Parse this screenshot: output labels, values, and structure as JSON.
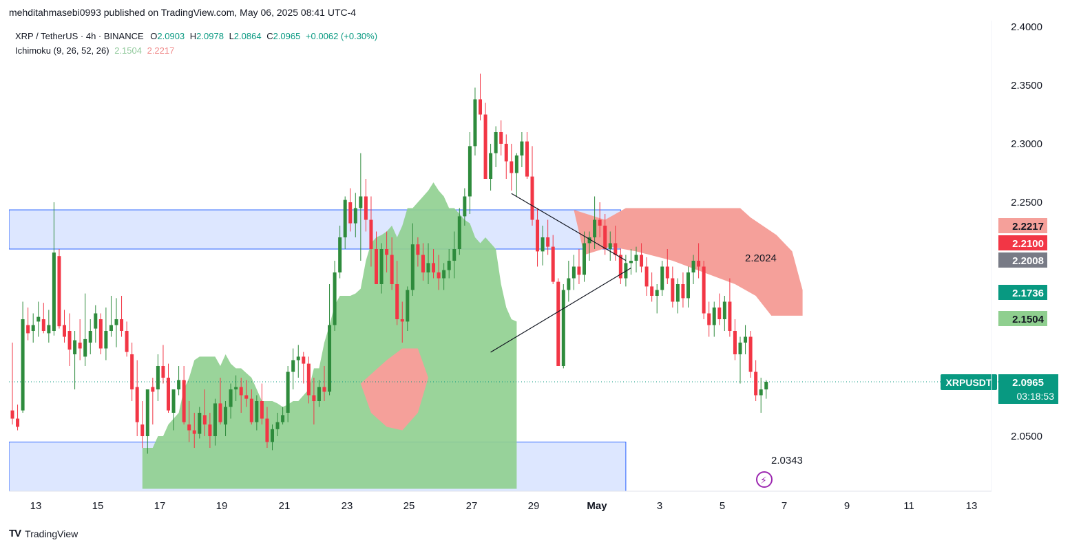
{
  "header": {
    "publisher_line": "mehditahmasebi0993 published on TradingView.com, May 06, 2025 08:41 UTC-4"
  },
  "legend": {
    "symbol": "XRP / TetherUS · 4h · BINANCE",
    "open_label": "O",
    "open": "2.0903",
    "high_label": "H",
    "high": "2.0978",
    "low_label": "L",
    "low": "2.0864",
    "close_label": "C",
    "close": "2.0965",
    "change": "+0.0062 (+0.30%)",
    "indicator": "Ichimoku (9, 26, 52, 26)",
    "indicator_a": "2.1504",
    "indicator_b": "2.2217"
  },
  "footer": {
    "brand": "TradingView"
  },
  "colors": {
    "up": "#089981",
    "up_candle": "#2e8b3c",
    "down": "#f23645",
    "cloud_bull": "#8fcf8f",
    "cloud_bear": "#f5a09a",
    "zone": "#dbe6ff",
    "zone_border": "#2962ff"
  },
  "chart_data": {
    "type": "candlestick",
    "y_axis": {
      "range": [
        2.0,
        2.4
      ],
      "ticks": [
        "2.4000",
        "2.3500",
        "2.3000",
        "2.2500",
        "2.0500"
      ]
    },
    "x_axis": {
      "ticks": [
        "13",
        "15",
        "17",
        "19",
        "21",
        "23",
        "25",
        "27",
        "29",
        "May",
        "3",
        "5",
        "7",
        "9",
        "11",
        "13"
      ]
    },
    "price_labels": [
      {
        "text": "2.2217",
        "value": 2.2217,
        "color": "#f5a09a",
        "text_color": "#131722"
      },
      {
        "text": "2.2100",
        "value": 2.21,
        "color": "#f23645",
        "text_color": "#ffffff"
      },
      {
        "text": "2.2008",
        "value": 2.2008,
        "color": "#787b86",
        "text_color": "#ffffff"
      },
      {
        "text": "2.1736",
        "value": 2.1736,
        "color": "#089981",
        "text_color": "#ffffff"
      },
      {
        "text": "2.1504",
        "value": 2.1504,
        "color": "#8fcf8f",
        "text_color": "#131722"
      }
    ],
    "last_price": {
      "symbol": "XRPUSDT",
      "price": "2.0965",
      "countdown": "03:18:53",
      "value": 2.0965
    },
    "annotations": [
      {
        "text": "2.2024",
        "value": 2.2024
      },
      {
        "text": "2.0343",
        "value": 2.0343
      }
    ],
    "zones": [
      {
        "low": 2.21,
        "high": 2.2435,
        "from_index": 0,
        "to_index": 117
      },
      {
        "low": 2.0,
        "high": 2.045,
        "from_index": 0,
        "to_index": 118
      }
    ],
    "trendlines": [
      {
        "from": [
          96,
          2.2575
        ],
        "to": [
          118,
          2.2002
        ]
      },
      {
        "from": [
          92,
          2.1218
        ],
        "to": [
          119,
          2.1938
        ]
      }
    ],
    "candles": [
      [
        2.072,
        2.13,
        2.06,
        2.065
      ],
      [
        2.065,
        2.077,
        2.055,
        2.058
      ],
      [
        2.072,
        2.165,
        2.07,
        2.15
      ],
      [
        2.145,
        2.16,
        2.132,
        2.138
      ],
      [
        2.14,
        2.155,
        2.13,
        2.145
      ],
      [
        2.148,
        2.165,
        2.135,
        2.152
      ],
      [
        2.15,
        2.164,
        2.138,
        2.14
      ],
      [
        2.138,
        2.158,
        2.13,
        2.145
      ],
      [
        2.14,
        2.25,
        2.136,
        2.207
      ],
      [
        2.204,
        2.21,
        2.142,
        2.144
      ],
      [
        2.145,
        2.158,
        2.13,
        2.135
      ],
      [
        2.14,
        2.155,
        2.11,
        2.124
      ],
      [
        2.12,
        2.14,
        2.09,
        2.132
      ],
      [
        2.13,
        2.15,
        2.115,
        2.125
      ],
      [
        2.118,
        2.172,
        2.11,
        2.133
      ],
      [
        2.13,
        2.15,
        2.12,
        2.14
      ],
      [
        2.142,
        2.162,
        2.13,
        2.155
      ],
      [
        2.15,
        2.155,
        2.12,
        2.125
      ],
      [
        2.125,
        2.16,
        2.115,
        2.14
      ],
      [
        2.14,
        2.17,
        2.135,
        2.145
      ],
      [
        2.145,
        2.168,
        2.126,
        2.15
      ],
      [
        2.15,
        2.17,
        2.135,
        2.14
      ],
      [
        2.14,
        2.148,
        2.118,
        2.122
      ],
      [
        2.12,
        2.13,
        2.08,
        2.09
      ],
      [
        2.092,
        2.115,
        2.05,
        2.062
      ],
      [
        2.06,
        2.08,
        2.04,
        2.05
      ],
      [
        2.05,
        2.07,
        2.035,
        2.09
      ],
      [
        2.092,
        2.1,
        2.06,
        2.088
      ],
      [
        2.09,
        2.12,
        2.08,
        2.11
      ],
      [
        2.11,
        2.128,
        2.095,
        2.1
      ],
      [
        2.1,
        2.112,
        2.07,
        2.072
      ],
      [
        2.07,
        2.09,
        2.055,
        2.09
      ],
      [
        2.09,
        2.11,
        2.085,
        2.098
      ],
      [
        2.098,
        2.11,
        2.06,
        2.062
      ],
      [
        2.06,
        2.08,
        2.045,
        2.055
      ],
      [
        2.055,
        2.07,
        2.04,
        2.052
      ],
      [
        2.052,
        2.075,
        2.048,
        2.07
      ],
      [
        2.068,
        2.09,
        2.05,
        2.06
      ],
      [
        2.06,
        2.07,
        2.04,
        2.05
      ],
      [
        2.05,
        2.082,
        2.042,
        2.078
      ],
      [
        2.078,
        2.1,
        2.06,
        2.062
      ],
      [
        2.06,
        2.08,
        2.05,
        2.075
      ],
      [
        2.075,
        2.095,
        2.065,
        2.09
      ],
      [
        2.09,
        2.102,
        2.08,
        2.092
      ],
      [
        2.092,
        2.1,
        2.07,
        2.085
      ],
      [
        2.085,
        2.098,
        2.075,
        2.082
      ],
      [
        2.082,
        2.09,
        2.06,
        2.062
      ],
      [
        2.062,
        2.085,
        2.055,
        2.08
      ],
      [
        2.08,
        2.095,
        2.06,
        2.065
      ],
      [
        2.065,
        2.075,
        2.04,
        2.045
      ],
      [
        2.045,
        2.06,
        2.038,
        2.056
      ],
      [
        2.056,
        2.07,
        2.05,
        2.062
      ],
      [
        2.062,
        2.075,
        2.06,
        2.068
      ],
      [
        2.07,
        2.11,
        2.062,
        2.105
      ],
      [
        2.105,
        2.125,
        2.09,
        2.115
      ],
      [
        2.115,
        2.128,
        2.1,
        2.118
      ],
      [
        2.118,
        2.122,
        2.095,
        2.112
      ],
      [
        2.112,
        2.118,
        2.078,
        2.085
      ],
      [
        2.085,
        2.1,
        2.06,
        2.08
      ],
      [
        2.08,
        2.098,
        2.075,
        2.092
      ],
      [
        2.092,
        2.11,
        2.08,
        2.088
      ],
      [
        2.088,
        2.18,
        2.085,
        2.145
      ],
      [
        2.145,
        2.2,
        2.14,
        2.19
      ],
      [
        2.19,
        2.23,
        2.185,
        2.22
      ],
      [
        2.22,
        2.255,
        2.21,
        2.252
      ],
      [
        2.25,
        2.262,
        2.225,
        2.232
      ],
      [
        2.232,
        2.258,
        2.22,
        2.245
      ],
      [
        2.245,
        2.292,
        2.2,
        2.255
      ],
      [
        2.255,
        2.27,
        2.225,
        2.235
      ],
      [
        2.235,
        2.255,
        2.195,
        2.21
      ],
      [
        2.21,
        2.225,
        2.18,
        2.18
      ],
      [
        2.18,
        2.215,
        2.172,
        2.21
      ],
      [
        2.21,
        2.225,
        2.19,
        2.205
      ],
      [
        2.205,
        2.22,
        2.175,
        2.18
      ],
      [
        2.18,
        2.2,
        2.145,
        2.15
      ],
      [
        2.15,
        2.165,
        2.13,
        2.148
      ],
      [
        2.148,
        2.178,
        2.14,
        2.175
      ],
      [
        2.175,
        2.232,
        2.17,
        2.214
      ],
      [
        2.214,
        2.22,
        2.195,
        2.205
      ],
      [
        2.205,
        2.215,
        2.183,
        2.19
      ],
      [
        2.19,
        2.215,
        2.18,
        2.198
      ],
      [
        2.198,
        2.21,
        2.185,
        2.19
      ],
      [
        2.19,
        2.205,
        2.175,
        2.185
      ],
      [
        2.185,
        2.198,
        2.175,
        2.192
      ],
      [
        2.192,
        2.21,
        2.185,
        2.2
      ],
      [
        2.2,
        2.225,
        2.185,
        2.21
      ],
      [
        2.21,
        2.245,
        2.205,
        2.238
      ],
      [
        2.238,
        2.262,
        2.23,
        2.255
      ],
      [
        2.255,
        2.31,
        2.24,
        2.298
      ],
      [
        2.298,
        2.348,
        2.29,
        2.338
      ],
      [
        2.338,
        2.36,
        2.32,
        2.325
      ],
      [
        2.325,
        2.335,
        2.27,
        2.27
      ],
      [
        2.27,
        2.3,
        2.26,
        2.292
      ],
      [
        2.292,
        2.315,
        2.28,
        2.31
      ],
      [
        2.31,
        2.32,
        2.29,
        2.3
      ],
      [
        2.3,
        2.308,
        2.27,
        2.285
      ],
      [
        2.285,
        2.3,
        2.26,
        2.275
      ],
      [
        2.275,
        2.292,
        2.255,
        2.29
      ],
      [
        2.29,
        2.31,
        2.28,
        2.302
      ],
      [
        2.302,
        2.31,
        2.27,
        2.272
      ],
      [
        2.272,
        2.298,
        2.23,
        2.235
      ],
      [
        2.235,
        2.245,
        2.195,
        2.208
      ],
      [
        2.208,
        2.23,
        2.196,
        2.22
      ],
      [
        2.22,
        2.235,
        2.205,
        2.212
      ],
      [
        2.212,
        2.222,
        2.18,
        2.182
      ],
      [
        2.182,
        2.185,
        2.11,
        2.11
      ],
      [
        2.11,
        2.18,
        2.108,
        2.175
      ],
      [
        2.175,
        2.2,
        2.165,
        2.185
      ],
      [
        2.185,
        2.205,
        2.175,
        2.195
      ],
      [
        2.195,
        2.21,
        2.18,
        2.188
      ],
      [
        2.188,
        2.225,
        2.182,
        2.215
      ],
      [
        2.215,
        2.225,
        2.2,
        2.22
      ],
      [
        2.22,
        2.255,
        2.21,
        2.235
      ],
      [
        2.235,
        2.25,
        2.22,
        2.23
      ],
      [
        2.23,
        2.24,
        2.205,
        2.21
      ],
      [
        2.21,
        2.225,
        2.2,
        2.215
      ],
      [
        2.215,
        2.23,
        2.2,
        2.205
      ],
      [
        2.205,
        2.21,
        2.18,
        2.185
      ],
      [
        2.185,
        2.205,
        2.178,
        2.198
      ],
      [
        2.198,
        2.21,
        2.188,
        2.2
      ],
      [
        2.2,
        2.212,
        2.19,
        2.205
      ],
      [
        2.205,
        2.215,
        2.19,
        2.195
      ],
      [
        2.195,
        2.203,
        2.17,
        2.178
      ],
      [
        2.178,
        2.19,
        2.165,
        2.17
      ],
      [
        2.17,
        2.18,
        2.155,
        2.175
      ],
      [
        2.175,
        2.2,
        2.17,
        2.195
      ],
      [
        2.195,
        2.21,
        2.18,
        2.185
      ],
      [
        2.185,
        2.195,
        2.16,
        2.165
      ],
      [
        2.165,
        2.185,
        2.155,
        2.18
      ],
      [
        2.18,
        2.19,
        2.16,
        2.168
      ],
      [
        2.168,
        2.195,
        2.16,
        2.19
      ],
      [
        2.19,
        2.205,
        2.18,
        2.2
      ],
      [
        2.2,
        2.215,
        2.185,
        2.195
      ],
      [
        2.195,
        2.2,
        2.15,
        2.155
      ],
      [
        2.155,
        2.165,
        2.135,
        2.145
      ],
      [
        2.145,
        2.165,
        2.135,
        2.16
      ],
      [
        2.16,
        2.172,
        2.145,
        2.15
      ],
      [
        2.15,
        2.17,
        2.14,
        2.165
      ],
      [
        2.165,
        2.185,
        2.135,
        2.14
      ],
      [
        2.14,
        2.15,
        2.115,
        2.12
      ],
      [
        2.12,
        2.135,
        2.095,
        2.13
      ],
      [
        2.13,
        2.145,
        2.12,
        2.135
      ],
      [
        2.135,
        2.14,
        2.1,
        2.105
      ],
      [
        2.105,
        2.115,
        2.08,
        2.085
      ],
      [
        2.085,
        2.1,
        2.07,
        2.09
      ],
      [
        2.09,
        2.098,
        2.082,
        2.0965
      ]
    ],
    "cloud": {
      "offset": 0,
      "span_a": [
        2.04,
        2.04,
        2.04,
        2.05,
        2.05,
        2.06,
        2.065,
        2.07,
        2.09,
        2.1,
        2.115,
        2.118,
        2.118,
        2.118,
        2.118,
        2.11,
        2.12,
        2.112,
        2.108,
        2.108,
        2.104,
        2.1,
        2.09,
        2.08,
        2.08,
        2.08,
        2.078,
        2.075,
        2.077,
        2.08,
        2.08,
        2.085,
        2.09,
        2.108,
        2.108,
        2.13,
        2.145,
        2.162,
        2.17,
        2.17,
        2.17,
        2.172,
        2.176,
        2.2,
        2.215,
        2.22,
        2.222,
        2.225,
        2.23,
        2.22,
        2.23,
        2.245,
        2.245,
        2.25,
        2.255,
        2.26,
        2.267,
        2.26,
        2.255,
        2.245,
        2.245,
        2.24,
        2.235,
        2.232,
        2.22,
        2.215,
        2.22,
        2.215,
        2.21,
        2.18,
        2.16,
        2.15,
        2.148
      ],
      "span_b": [
        2.005,
        2.005,
        2.005,
        2.005,
        2.005,
        2.005,
        2.005,
        2.005,
        2.005,
        2.005,
        2.005,
        2.005,
        2.005,
        2.005,
        2.005,
        2.005,
        2.005,
        2.005,
        2.005,
        2.005,
        2.005,
        2.005,
        2.005,
        2.005,
        2.005,
        2.005,
        2.005,
        2.005,
        2.005,
        2.005,
        2.005,
        2.005,
        2.005,
        2.005,
        2.005,
        2.005,
        2.005,
        2.005,
        2.005,
        2.005,
        2.005,
        2.005,
        2.005,
        2.005,
        2.005,
        2.005,
        2.005,
        2.005,
        2.005,
        2.005,
        2.005,
        2.005,
        2.005,
        2.005,
        2.005,
        2.005,
        2.005,
        2.005,
        2.005,
        2.005,
        2.005,
        2.005,
        2.005,
        2.005,
        2.005,
        2.005,
        2.005,
        2.005,
        2.005,
        2.005,
        2.005,
        2.005,
        2.005
      ]
    }
  }
}
